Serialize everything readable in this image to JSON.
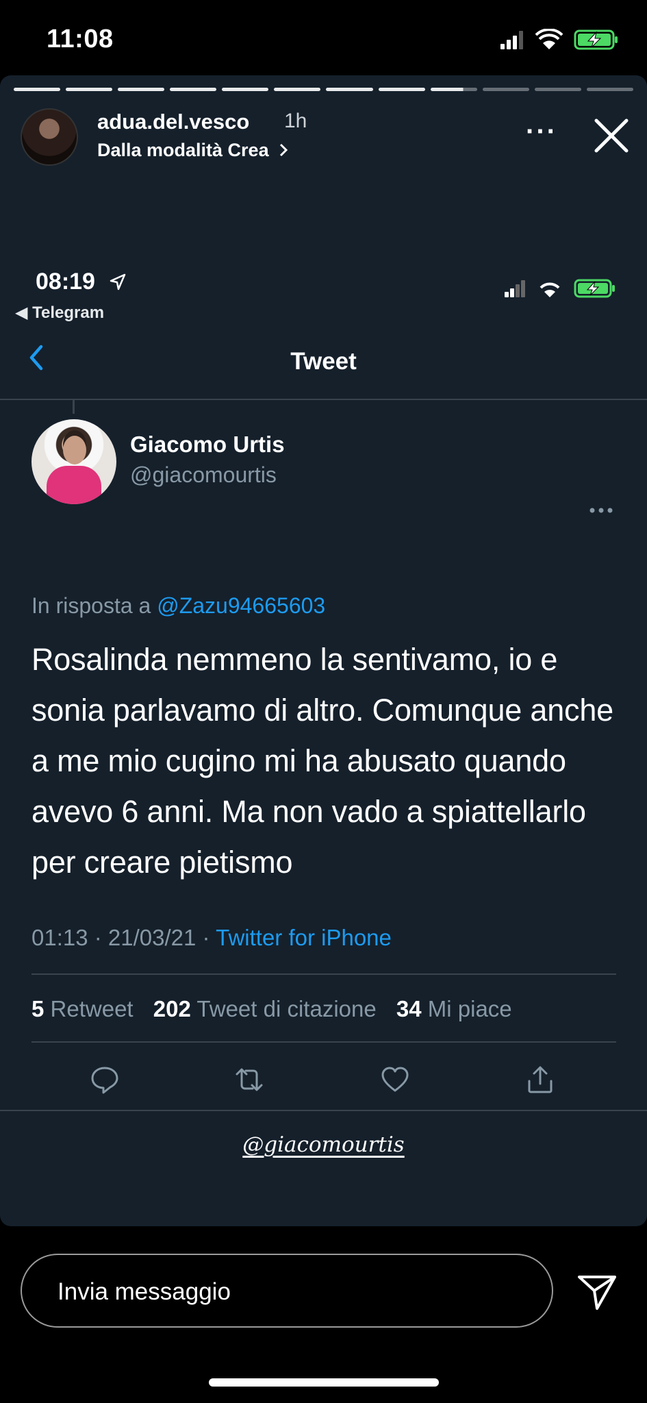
{
  "status_bar": {
    "time": "11:08",
    "icons": [
      "signal-icon",
      "wifi-icon",
      "battery-charging-icon"
    ]
  },
  "story": {
    "username": "adua.del.vesco",
    "age": "1h",
    "subtitle": "Dalla modalità Crea",
    "more_label": "···",
    "segments_total": 12,
    "segments_viewed": 8,
    "current_segment_progress": 0.7
  },
  "inner_status": {
    "time": "08:19",
    "back_app": "◀ Telegram"
  },
  "twitter": {
    "nav_title": "Tweet",
    "tweet": {
      "name": "Giacomo Urtis",
      "handle": "@giacomourtis",
      "reply_prefix": "In risposta a",
      "reply_to": "@Zazu94665603",
      "text": "Rosalinda nemmeno la sentivamo, io e sonia parlavamo di altro. Comunque anche a me mio cugino mi ha abusato quando avevo 6 anni. Ma non vado a spiattellarlo per creare pietismo",
      "time_date": "01:13 · 21/03/21 ·",
      "source": "Twitter for iPhone",
      "retweets": "5",
      "retweets_label": "Retweet",
      "quotes": "202",
      "quotes_label": "Tweet di citazione",
      "likes": "34",
      "likes_label": "Mi piace"
    }
  },
  "mention_sticker": "@giacomourtis",
  "message_placeholder": "Invia messaggio",
  "colors": {
    "twitter_bg": "#15202b",
    "twitter_blue": "#1d9bf0",
    "secondary_text": "#8899a6",
    "divider": "#38444d"
  }
}
